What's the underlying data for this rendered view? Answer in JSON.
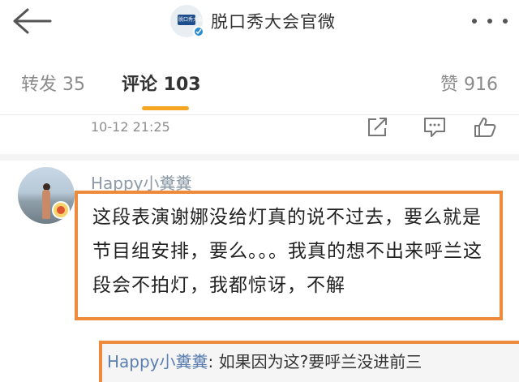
{
  "header": {
    "title": "脱口秀大会官微",
    "logo_text": "脱口秀大会"
  },
  "tabs": {
    "repost": "转发 35",
    "comment": "评论 103",
    "like": "赞 916"
  },
  "post_meta": {
    "timestamp": "10-12 21:25"
  },
  "comment": {
    "username": "Happy小糞糞",
    "text": "这段表演谢娜没给灯真的说不过去，要么就是节目组安排，要么。。。我真的想不出来呼兰这段会不拍灯，我都惊讶，不解"
  },
  "reply": {
    "username": "Happy小糞糞",
    "separator": ":",
    "text": " 如果因为这?要呼兰没进前三"
  },
  "colors": {
    "accent": "#f5a623",
    "highlight_border": "#ee8a3c",
    "link": "#5b7fb1"
  }
}
